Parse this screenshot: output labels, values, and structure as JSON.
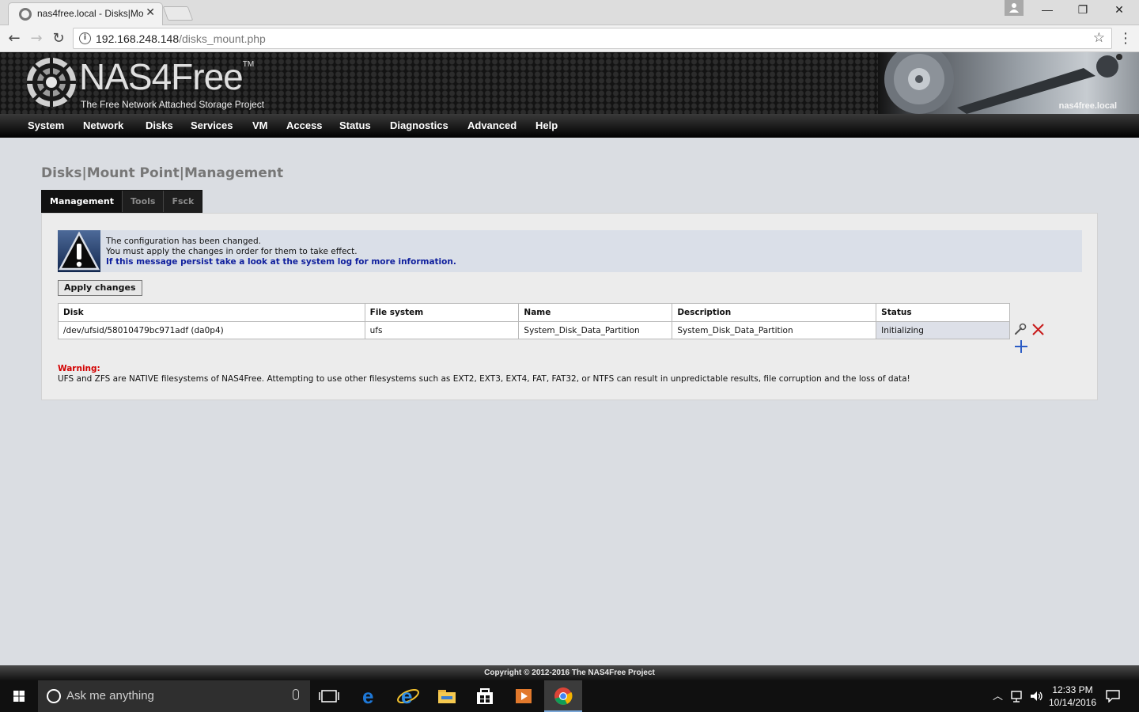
{
  "browser": {
    "tab_title": "nas4free.local - Disks|Mo",
    "url_host": "192.168.248.148",
    "url_path": "/disks_mount.php"
  },
  "header": {
    "logo_text": "NAS4Free",
    "logo_tm": "TM",
    "tagline": "The Free Network Attached Storage Project",
    "hostname": "nas4free.local"
  },
  "nav": {
    "items": [
      "System",
      "Network",
      "Disks",
      "Services",
      "VM",
      "Access",
      "Status",
      "Diagnostics",
      "Advanced",
      "Help"
    ]
  },
  "page": {
    "title": "Disks|Mount Point|Management",
    "tabs": [
      {
        "label": "Management",
        "active": true
      },
      {
        "label": "Tools",
        "active": false
      },
      {
        "label": "Fsck",
        "active": false
      }
    ]
  },
  "alert": {
    "line1": "The configuration has been changed.",
    "line2": "You must apply the changes in order for them to take effect.",
    "line3": "If this message persist take a look at the system log for more information."
  },
  "apply_button": "Apply changes",
  "table": {
    "headers": [
      "Disk",
      "File system",
      "Name",
      "Description",
      "Status"
    ],
    "rows": [
      [
        "/dev/ufsid/58010479bc971adf (da0p4)",
        "ufs",
        "System_Disk_Data_Partition",
        "System_Disk_Data_Partition",
        "Initializing"
      ]
    ]
  },
  "warning": {
    "title": "Warning:",
    "text": "UFS and ZFS are NATIVE filesystems of NAS4Free. Attempting to use other filesystems such as EXT2, EXT3, EXT4, FAT, FAT32, or NTFS can result in unpredictable results, file corruption and the loss of data!"
  },
  "footer": "Copyright © 2012-2016 The NAS4Free Project",
  "taskbar": {
    "search_placeholder": "Ask me anything",
    "time": "12:33 PM",
    "date": "10/14/2016"
  },
  "colors": {
    "accent_blue": "#0f1f9d",
    "warning_red": "#d30000",
    "navbar": "#000000"
  }
}
